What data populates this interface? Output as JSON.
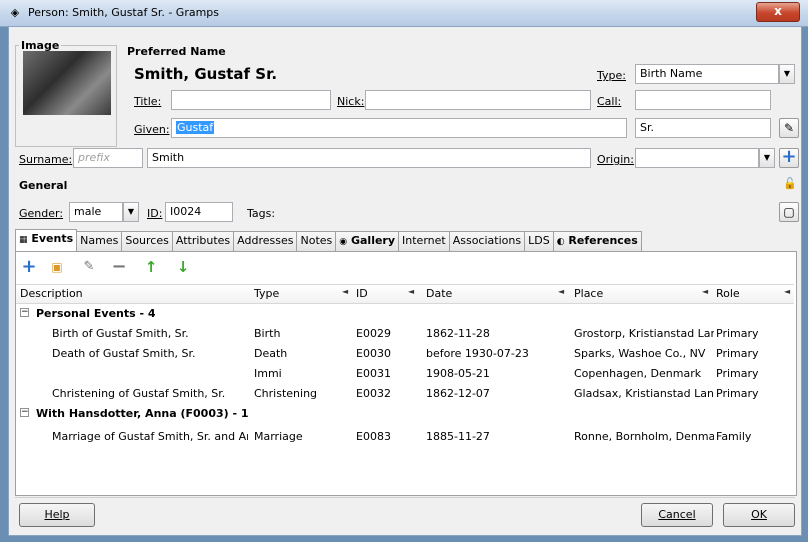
{
  "window": {
    "title": "Person: Smith, Gustaf Sr. - Gramps",
    "close_label": "x"
  },
  "image_section": {
    "label": "Image"
  },
  "preferred_name": {
    "heading": "Preferred Name",
    "display_name": "Smith, Gustaf Sr.",
    "type_label": "Type:",
    "type_value": "Birth Name",
    "title_label": "Title:",
    "title_value": "",
    "nick_label": "Nick:",
    "nick_value": "",
    "call_label": "Call:",
    "call_value": "",
    "given_label": "Given:",
    "given_value": "Gustaf",
    "suffix_value": "Sr.",
    "surname_label": "Surname:",
    "prefix_placeholder": "prefix",
    "surname_value": "Smith",
    "origin_label": "Origin:",
    "origin_value": ""
  },
  "general": {
    "heading": "General",
    "gender_label": "Gender:",
    "gender_value": "male",
    "id_label": "ID:",
    "id_value": "I0024",
    "tags_label": "Tags:"
  },
  "tabs": [
    "Events",
    "Names",
    "Sources",
    "Attributes",
    "Addresses",
    "Notes",
    "Gallery",
    "Internet",
    "Associations",
    "LDS",
    "References"
  ],
  "columns": {
    "description": "Description",
    "type": "Type",
    "id": "ID",
    "date": "Date",
    "place": "Place",
    "role": "Role"
  },
  "groups": [
    {
      "title": "Personal Events - 4",
      "rows": [
        {
          "description": "Birth of Gustaf Smith, Sr.",
          "type": "Birth",
          "id": "E0029",
          "date": "1862-11-28",
          "place": "Grostorp, Kristianstad Lan...",
          "role": "Primary"
        },
        {
          "description": "Death of Gustaf Smith, Sr.",
          "type": "Death",
          "id": "E0030",
          "date": "before 1930-07-23",
          "place": "Sparks, Washoe Co., NV",
          "role": "Primary"
        },
        {
          "description": "",
          "type": "Immi",
          "id": "E0031",
          "date": "1908-05-21",
          "place": "Copenhagen, Denmark",
          "role": "Primary"
        },
        {
          "description": "Christening of Gustaf Smith, Sr.",
          "type": "Christening",
          "id": "E0032",
          "date": "1862-12-07",
          "place": "Gladsax, Kristianstad Lan, ...",
          "role": "Primary"
        }
      ]
    },
    {
      "title": "With Hansdotter, Anna (F0003) - 1",
      "rows": [
        {
          "description": "Marriage of Gustaf Smith, Sr. and Anna...",
          "type": "Marriage",
          "id": "E0083",
          "date": "1885-11-27",
          "place": "Ronne, Bornholm, Denma...",
          "role": "Family"
        }
      ]
    }
  ],
  "buttons": {
    "help": "Help",
    "cancel": "Cancel",
    "ok": "OK"
  },
  "colors": {
    "selection": "#3399ff",
    "add_icon": "#2b6fc9",
    "arrow_icon": "#3aa82a"
  }
}
